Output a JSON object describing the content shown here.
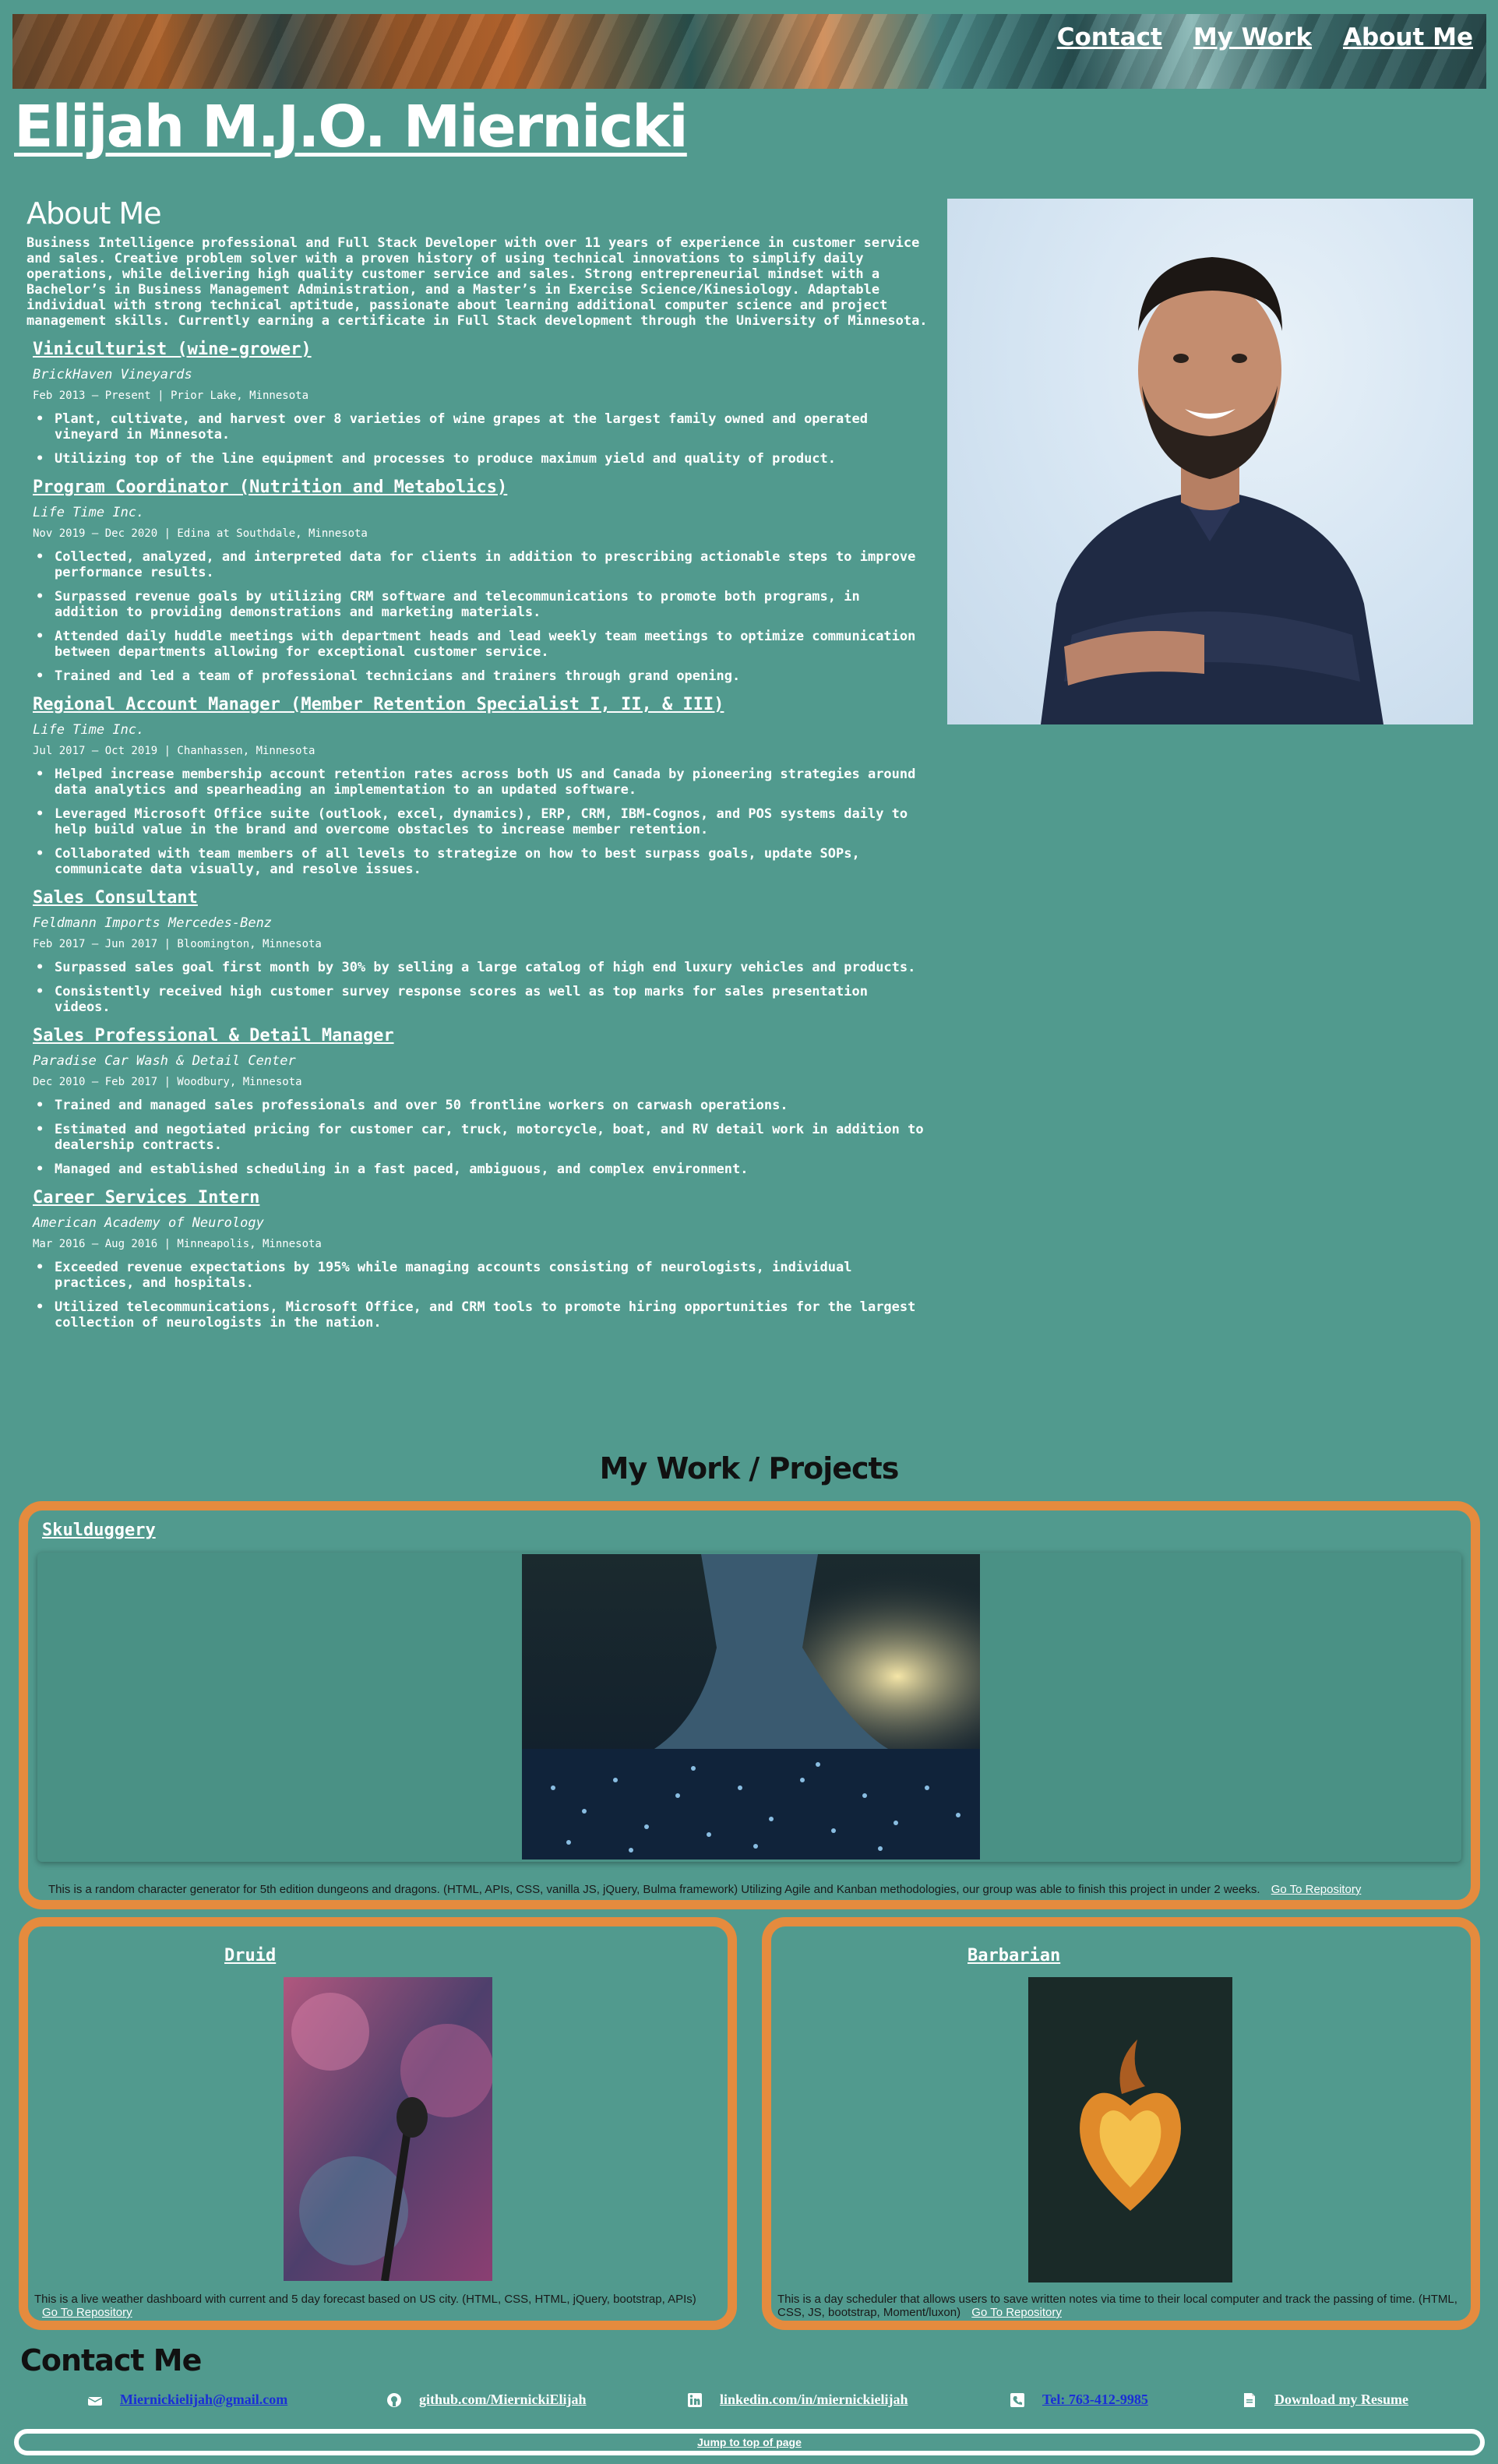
{
  "nav": {
    "contact": "Contact",
    "work": "My Work",
    "about": "About Me"
  },
  "site_title": "Elijah M.J.O. Miernicki",
  "about": {
    "heading": "About Me",
    "intro": "Business Intelligence professional and Full Stack Developer with over 11 years of experience in customer service and sales. Creative problem solver with a proven history of using technical innovations to simplify daily operations, while delivering high quality customer service and sales. Strong entrepreneurial mindset with a Bachelor’s in Business Management Administration, and a Master’s in Exercise Science/Kinesiology. Adaptable individual with strong technical aptitude, passionate about learning additional computer science and project management skills. Currently earning a certificate in Full Stack development through the University of Minnesota."
  },
  "jobs": [
    {
      "title": "Viniculturist (wine-grower)",
      "company": "BrickHaven Vineyards",
      "meta": "Feb 2013 – Present | Prior Lake, Minnesota",
      "bullets": [
        "Plant, cultivate, and harvest over 8 varieties of wine grapes at the largest family owned and operated vineyard in Minnesota.",
        "Utilizing top of the line equipment and processes to produce maximum yield and quality of product."
      ]
    },
    {
      "title": "Program Coordinator (Nutrition and Metabolics)",
      "company": "Life Time Inc.",
      "meta": "Nov 2019 – Dec 2020 | Edina at Southdale, Minnesota",
      "bullets": [
        "Collected, analyzed, and interpreted data for clients in addition to prescribing actionable steps to improve performance results.",
        "Surpassed revenue goals by utilizing CRM software and telecommunications to promote both programs, in addition to providing demonstrations and marketing materials.",
        "Attended daily huddle meetings with department heads and lead weekly team meetings to optimize communication between departments allowing for exceptional customer service.",
        "Trained and led a team of professional technicians and trainers through grand opening."
      ]
    },
    {
      "title": "Regional Account Manager (Member Retention Specialist I, II, & III)",
      "company": "Life Time Inc.",
      "meta": "Jul 2017 – Oct 2019 | Chanhassen, Minnesota",
      "bullets": [
        "Helped increase membership account retention rates across both US and Canada by pioneering strategies around data analytics and spearheading an implementation to an updated software.",
        "Leveraged Microsoft Office suite (outlook, excel, dynamics), ERP, CRM, IBM-Cognos, and POS systems daily to help build value in the brand and overcome obstacles to increase member retention.",
        "Collaborated with team members of all levels to strategize on how to best surpass goals, update SOPs, communicate data visually, and resolve issues."
      ]
    },
    {
      "title": "Sales Consultant",
      "company": "Feldmann Imports Mercedes-Benz",
      "meta": "Feb 2017 – Jun 2017 | Bloomington, Minnesota",
      "bullets": [
        "Surpassed sales goal first month by 30% by selling a large catalog of high end luxury vehicles and products.",
        "Consistently received high customer survey response scores as well as top marks for sales presentation videos."
      ]
    },
    {
      "title": "Sales Professional & Detail Manager",
      "company": "Paradise Car Wash & Detail Center",
      "meta": "Dec 2010 – Feb 2017 | Woodbury, Minnesota",
      "bullets": [
        "Trained and managed sales professionals and over 50 frontline workers on carwash operations.",
        "Estimated and negotiated pricing for customer car, truck, motorcycle, boat, and RV detail work in addition to dealership contracts.",
        "Managed and established scheduling in a fast paced, ambiguous, and complex environment."
      ]
    },
    {
      "title": "Career Services Intern",
      "company": "American Academy of Neurology",
      "meta": "Mar 2016 – Aug 2016 | Minneapolis, Minnesota",
      "bullets": [
        "Exceeded revenue expectations by 195% while managing accounts consisting of neurologists, individual practices, and hospitals.",
        "Utilized telecommunications, Microsoft Office, and CRM tools to promote hiring opportunities for the largest collection of neurologists in the nation."
      ]
    }
  ],
  "projects": {
    "heading": "My Work / Projects",
    "skulduggery": {
      "title": "Skulduggery",
      "desc": "This is a random character generator for 5th edition dungeons and dragons. (HTML, APIs, CSS, vanilla JS, jQuery, Bulma framework) Utilizing Agile and Kanban methodologies, our group was able to finish this project in under 2 weeks.",
      "link": "Go To Repository"
    },
    "druid": {
      "title": "Druid",
      "desc": "This is a live weather dashboard with current and 5 day forecast based on US city. (HTML, CSS, HTML, jQuery, bootstrap, APIs)",
      "link": "Go To Repository"
    },
    "barbarian": {
      "title": "Barbarian",
      "desc": "This is a day scheduler that allows users to save written notes via time to their local computer and track the passing of time. (HTML, CSS, JS, bootstrap, Moment/luxon)",
      "link": "Go To Repository"
    }
  },
  "contact": {
    "heading": "Contact Me",
    "email": "Miernickielijah@gmail.com",
    "github": "github.com/MiernickiElijah",
    "linkedin": "linkedin.com/in/miernickielijah",
    "phone": "Tel: 763-412-9985",
    "resume": "Download my Resume",
    "jump": "Jump to top of page"
  },
  "colors": {
    "background": "#519a8e",
    "card_border": "#e58b3e",
    "text": "#ffffff"
  }
}
